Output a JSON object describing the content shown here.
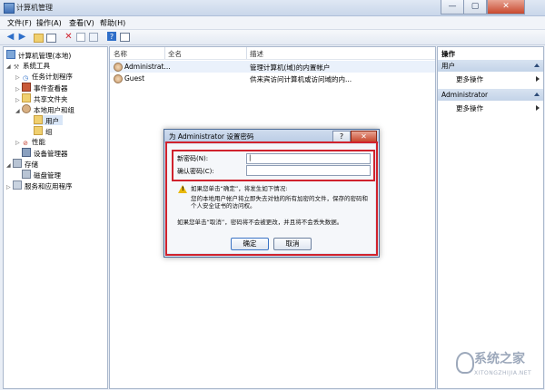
{
  "window": {
    "title": "计算机管理",
    "buttons": [
      "—",
      "▢",
      "✕"
    ]
  },
  "menubar": {
    "items": [
      "文件(F)",
      "操作(A)",
      "查看(V)",
      "帮助(H)"
    ]
  },
  "toolbar": {
    "icons": [
      "back-icon",
      "forward-icon",
      "up-folder-icon",
      "console-icon",
      "delete-icon",
      "properties-icon",
      "export-icon",
      "help-icon",
      "show-hide-icon"
    ]
  },
  "tree": {
    "items": [
      {
        "label": "计算机管理(本地)",
        "level": 0,
        "arrow": ""
      },
      {
        "label": "系统工具",
        "level": 1,
        "arrow": "◢"
      },
      {
        "label": "任务计划程序",
        "level": 2,
        "arrow": "▷"
      },
      {
        "label": "事件查看器",
        "level": 2,
        "arrow": "▷"
      },
      {
        "label": "共享文件夹",
        "level": 2,
        "arrow": "▷"
      },
      {
        "label": "本地用户和组",
        "level": 2,
        "arrow": "◢"
      },
      {
        "label": "用户",
        "level": 3,
        "arrow": ""
      },
      {
        "label": "组",
        "level": 3,
        "arrow": ""
      },
      {
        "label": "性能",
        "level": 2,
        "arrow": "▷"
      },
      {
        "label": "设备管理器",
        "level": 2,
        "arrow": ""
      },
      {
        "label": "存储",
        "level": 1,
        "arrow": "◢"
      },
      {
        "label": "磁盘管理",
        "level": 2,
        "arrow": ""
      },
      {
        "label": "服务和应用程序",
        "level": 1,
        "arrow": "▷"
      }
    ]
  },
  "list": {
    "columns": [
      "名称",
      "全名",
      "描述"
    ],
    "rows": [
      {
        "name": "Administrat...",
        "fullname": "",
        "desc": "管理计算机(域)的内置帐户"
      },
      {
        "name": "Guest",
        "fullname": "",
        "desc": "供来宾访问计算机或访问域的内..."
      }
    ]
  },
  "actions": {
    "title": "操作",
    "sections": [
      {
        "header": "用户",
        "item": "更多操作"
      },
      {
        "header": "Administrator",
        "item": "更多操作"
      }
    ]
  },
  "dialog": {
    "title": "为 Administrator 设置密码",
    "help": "?",
    "close": "✕",
    "new_password_label": "新密码(N):",
    "confirm_password_label": "确认密码(C):",
    "warn_heading": "如果您单击“确定”，将发生如下情况:",
    "warn_detail": "您的本地用户帐户将立即失去对他的所有加密的文件，保存的密码和个人安全证书的访问权。",
    "cancel_note": "如果您单击“取消”，密码将不会被更改，并且将不会丢失数据。",
    "ok_label": "确定",
    "cancel_label": "取消"
  },
  "watermark": {
    "text": "系统之家",
    "sub": "XITONGZHIJIA.NET"
  }
}
